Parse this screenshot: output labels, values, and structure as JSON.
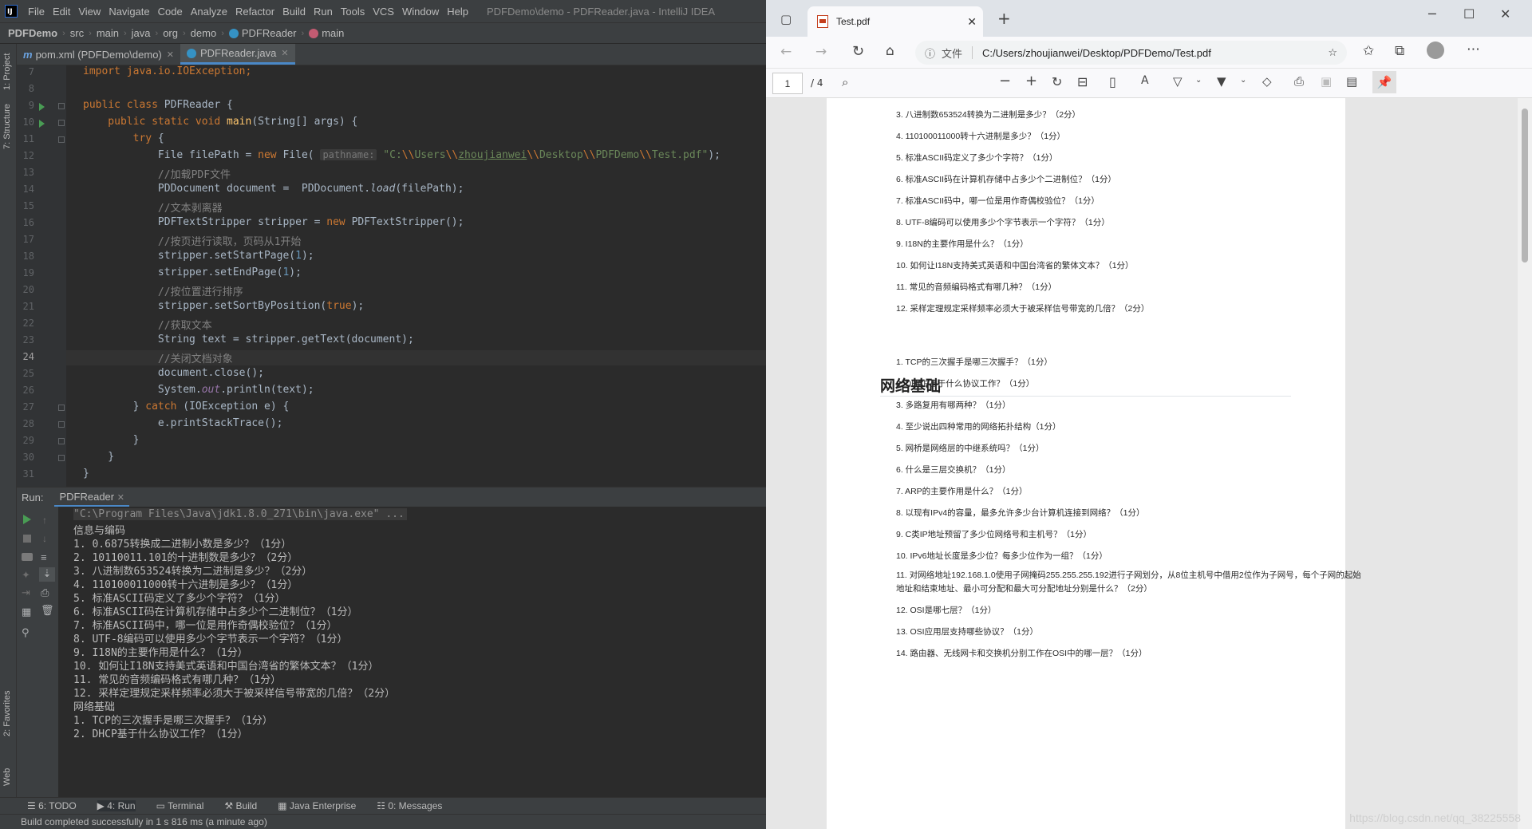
{
  "ide": {
    "menu": [
      "File",
      "Edit",
      "View",
      "Navigate",
      "Code",
      "Analyze",
      "Refactor",
      "Build",
      "Run",
      "Tools",
      "VCS",
      "Window",
      "Help"
    ],
    "window_title": "PDFDemo\\demo - PDFReader.java - IntelliJ IDEA",
    "breadcrumbs": [
      "PDFDemo",
      "src",
      "main",
      "java",
      "org",
      "demo",
      "PDFReader",
      "main"
    ],
    "left_strip": {
      "project": "1: Project",
      "structure": "7: Structure",
      "favorites": "2: Favorites",
      "web": "Web"
    },
    "tabs": [
      {
        "label": "pom.xml (PDFDemo\\demo)"
      },
      {
        "label": "PDFReader.java"
      }
    ],
    "line_numbers": [
      "7",
      "8",
      "9",
      "10",
      "11",
      "12",
      "13",
      "14",
      "15",
      "16",
      "17",
      "18",
      "19",
      "20",
      "21",
      "22",
      "23",
      "24",
      "25",
      "26",
      "27",
      "28",
      "29",
      "30",
      "31"
    ],
    "code": {
      "l7": "import java.io.IOException;",
      "l9a": "public class ",
      "l9b": "PDFReader {",
      "l10a": "    public static void ",
      "l10b": "main",
      "l10c": "(String[] args) {",
      "l11a": "        try ",
      "l11b": "{",
      "l12a": "            File filePath = ",
      "l12b": "new ",
      "l12c": "File( ",
      "l12hint": "pathname:",
      "l12s1": " \"C:",
      "l12e1": "\\\\",
      "l12s2": "Users",
      "l12e2": "\\\\",
      "l12s3": "zhoujianwei",
      "l12e3": "\\\\",
      "l12s4": "Desktop",
      "l12e4": "\\\\",
      "l12s5": "PDFDemo",
      "l12e5": "\\\\",
      "l12s6": "Test.pdf\"",
      "l12end": ");",
      "l13": "            //加载PDF文件",
      "l14a": "            PDDocument document =  PDDocument.",
      "l14b": "load",
      "l14c": "(filePath);",
      "l15": "            //文本剥离器",
      "l16a": "            PDFTextStripper stripper = ",
      "l16b": "new ",
      "l16c": "PDFTextStripper();",
      "l17": "            //按页进行读取，页码从1开始",
      "l18a": "            stripper.setStartPage(",
      "l18b": "1",
      "l18c": ");",
      "l19a": "            stripper.setEndPage(",
      "l19b": "1",
      "l19c": ");",
      "l20": "            //按位置进行排序",
      "l21a": "            stripper.setSortByPosition(",
      "l21b": "true",
      "l21c": ");",
      "l22": "            //获取文本",
      "l23": "            String text = stripper.getText(document);",
      "l24": "            //关闭文档对象",
      "l25": "            document.close();",
      "l26a": "            System.",
      "l26b": "out",
      "l26c": ".println(text);",
      "l27a": "        } ",
      "l27b": "catch ",
      "l27c": "(IOException e) {",
      "l28": "            e.printStackTrace();",
      "l29": "        }",
      "l30": "    }",
      "l31": "}"
    },
    "run": {
      "label": "Run:",
      "tab": "PDFReader",
      "console": [
        "\"C:\\Program Files\\Java\\jdk1.8.0_271\\bin\\java.exe\" ...",
        "信息与编码",
        "1. 0.6875转换成二进制小数是多少？（1分）",
        "2. 10110011.101的十进制数是多少？（2分）",
        "3. 八进制数653524转换为二进制是多少？（2分）",
        "4. 110100011000转十六进制是多少？（1分）",
        "5. 标准ASCII码定义了多少个字符？（1分）",
        "6. 标准ASCII码在计算机存储中占多少个二进制位？（1分）",
        "7. 标准ASCII码中，哪一位是用作奇偶校验位？（1分）",
        "8. UTF-8编码可以使用多少个字节表示一个字符？（1分）",
        "9. I18N的主要作用是什么？（1分）",
        "10. 如何让I18N支持美式英语和中国台湾省的繁体文本？（1分）",
        "11. 常见的音频编码格式有哪几种？（1分）",
        "12. 采样定理规定采样频率必须大于被采样信号带宽的几倍？（2分）",
        "网络基础",
        "1. TCP的三次握手是哪三次握手？（1分）",
        "2. DHCP基于什么协议工作？（1分）"
      ]
    },
    "bottom_tools": [
      "6: TODO",
      "4: Run",
      "Terminal",
      "Build",
      "Java Enterprise",
      "0: Messages"
    ],
    "status": "Build completed successfully in 1 s 816 ms (a minute ago)"
  },
  "browser": {
    "tab_title": "Test.pdf",
    "url_prefix": "文件",
    "url": "C:/Users/zhoujianwei/Desktop/PDFDemo/Test.pdf",
    "page_number": "1",
    "page_total": "/ 4",
    "pdf_items_top": [
      "3. 八进制数653524转换为二进制是多少？（2分）",
      "4. 110100011000转十六进制是多少？（1分）",
      "5. 标准ASCII码定义了多少个字符？（1分）",
      "6. 标准ASCII码在计算机存储中占多少个二进制位？（1分）",
      "7. 标准ASCII码中，哪一位是用作奇偶校验位？（1分）",
      "8. UTF-8编码可以使用多少个字节表示一个字符？（1分）",
      "9. I18N的主要作用是什么？（1分）",
      "10. 如何让I18N支持美式英语和中国台湾省的繁体文本？（1分）",
      "11. 常见的音频编码格式有哪几种？（1分）",
      "12. 采样定理规定采样频率必须大于被采样信号带宽的几倍？（2分）"
    ],
    "pdf_heading": "网络基础",
    "pdf_items_net": [
      "1. TCP的三次握手是哪三次握手？（1分）",
      "2. DHCP基于什么协议工作？（1分）",
      "3. 多路复用有哪两种？（1分）",
      "4. 至少说出四种常用的网络拓扑结构（1分）",
      "5. 网桥是网络层的中继系统吗？（1分）",
      "6. 什么是三层交换机？（1分）",
      "7. ARP的主要作用是什么？（1分）",
      "8. 以现有IPv4的容量，最多允许多少台计算机连接到网络？（1分）",
      "9. C类IP地址预留了多少位网络号和主机号？（1分）",
      "10. IPv6地址长度是多少位？每多少位作为一组？（1分）",
      "11. 对网络地址192.168.1.0使用子网掩码255.255.255.192进行子网划分，从8位主机号中借用2位作为子网号，每个子网的起始地址和结束地址、最小可分配和最大可分配地址分别是什么？（2分）",
      "12. OSI是哪七层？（1分）",
      "13. OSI应用层支持哪些协议？（1分）",
      "14. 路由器、无线网卡和交换机分别工作在OSI中的哪一层？（1分）"
    ],
    "watermark": "https://blog.csdn.net/qq_38225558"
  }
}
